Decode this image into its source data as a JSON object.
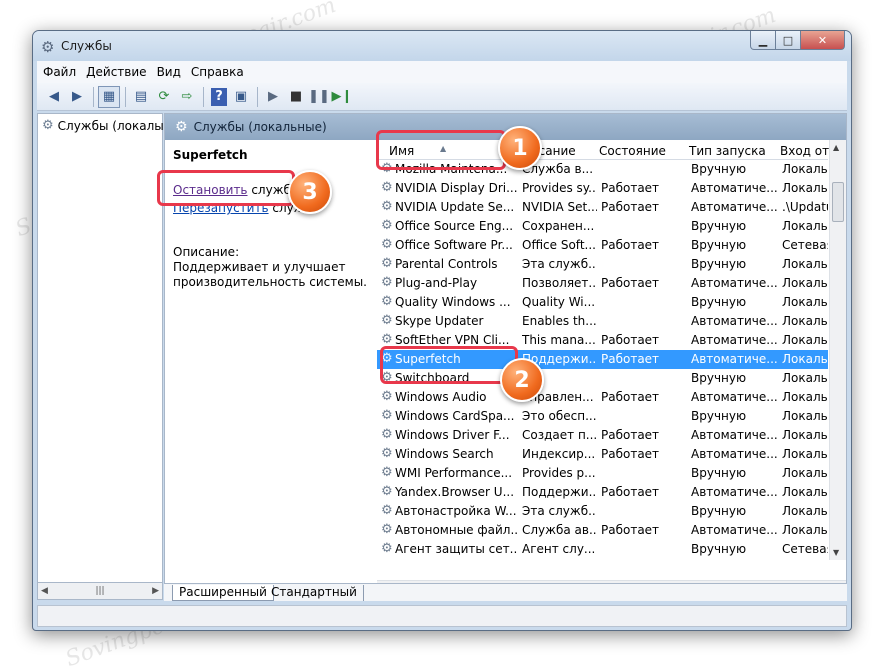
{
  "window": {
    "title": "Службы",
    "buttons": {
      "minimize": "▁",
      "maximize": "□",
      "close": "✕"
    }
  },
  "menu": [
    {
      "label": "Файл"
    },
    {
      "label": "Действие"
    },
    {
      "label": "Вид"
    },
    {
      "label": "Справка"
    }
  ],
  "toolbar": {
    "icons": [
      "back-arrow-icon",
      "forward-arrow-icon",
      "show-tree-icon",
      "properties-icon",
      "refresh-icon",
      "export-icon",
      "help-icon",
      "mmc-icon",
      "play-icon",
      "stop-icon",
      "pause-icon",
      "restart-icon"
    ]
  },
  "tree": {
    "item": "Службы (локалы"
  },
  "content": {
    "header": "Службы (локальные)",
    "selected_service": "Superfetch",
    "stop_link": "Остановить",
    "stop_suffix": " службу",
    "restart_link": "Перезапустить",
    "restart_suffix": " служб",
    "desc_label": "Описание:",
    "desc_text": "Поддерживает и улучшает производительность системы."
  },
  "columns": {
    "name": "Имя",
    "desc": "писание",
    "state": "Состояние",
    "startup": "Тип запуска",
    "logon": "Вход от и"
  },
  "services": [
    {
      "name": "Mozilla Maintena...",
      "desc": "Служба в...",
      "state": "",
      "startup": "Вручную",
      "logon": "Локальн"
    },
    {
      "name": "NVIDIA Display Dri...",
      "desc": "Provides sy...",
      "state": "Работает",
      "startup": "Автоматиче...",
      "logon": "Локальн"
    },
    {
      "name": "NVIDIA Update Se...",
      "desc": "NVIDIA Set...",
      "state": "Работает",
      "startup": "Автоматиче...",
      "logon": ".\\Updatus"
    },
    {
      "name": "Office  Source Eng...",
      "desc": "Сохранен...",
      "state": "",
      "startup": "Вручную",
      "logon": "Локальн"
    },
    {
      "name": "Office Software Pr...",
      "desc": "Office Soft...",
      "state": "Работает",
      "startup": "Вручную",
      "logon": "Сетевая с"
    },
    {
      "name": "Parental Controls",
      "desc": "Эта служб...",
      "state": "",
      "startup": "Вручную",
      "logon": "Локальн"
    },
    {
      "name": "Plug-and-Play",
      "desc": "Позволяет...",
      "state": "Работает",
      "startup": "Автоматиче...",
      "logon": "Локальн"
    },
    {
      "name": "Quality Windows ...",
      "desc": "Quality Wi...",
      "state": "",
      "startup": "Вручную",
      "logon": "Локальн"
    },
    {
      "name": "Skype Updater",
      "desc": "Enables th...",
      "state": "",
      "startup": "Автоматиче...",
      "logon": "Локальн"
    },
    {
      "name": "SoftEther VPN Cli...",
      "desc": "This mana...",
      "state": "Работает",
      "startup": "Автоматиче...",
      "logon": "Локальн"
    },
    {
      "name": "Superfetch",
      "desc": "Поддержи...",
      "state": "Работает",
      "startup": "Автоматиче...",
      "logon": "Локальн",
      "selected": true
    },
    {
      "name": "Switchboard",
      "desc": "",
      "state": "",
      "startup": "Вручную",
      "logon": "Локальн"
    },
    {
      "name": "Windows Audio",
      "desc": "Управлен...",
      "state": "Работает",
      "startup": "Автоматиче...",
      "logon": "Локальн"
    },
    {
      "name": "Windows CardSpa...",
      "desc": "Это обесп...",
      "state": "",
      "startup": "Вручную",
      "logon": "Локальн"
    },
    {
      "name": "Windows Driver F...",
      "desc": "Создает п...",
      "state": "Работает",
      "startup": "Автоматиче...",
      "logon": "Локальн"
    },
    {
      "name": "Windows Search",
      "desc": "Индексир...",
      "state": "Работает",
      "startup": "Автоматиче...",
      "logon": "Локальн"
    },
    {
      "name": "WMI Performance...",
      "desc": "Provides p...",
      "state": "",
      "startup": "Вручную",
      "logon": "Локальн"
    },
    {
      "name": "Yandex.Browser U...",
      "desc": "Поддержи...",
      "state": "Работает",
      "startup": "Автоматиче...",
      "logon": "Локальн"
    },
    {
      "name": "Автонастройка W...",
      "desc": "Эта служб...",
      "state": "",
      "startup": "Вручную",
      "logon": "Локальн"
    },
    {
      "name": "Автономные файл...",
      "desc": "Служба ав...",
      "state": "Работает",
      "startup": "Автоматиче...",
      "logon": "Локальн"
    },
    {
      "name": "Агент защиты сет...",
      "desc": "Агент слу...",
      "state": "",
      "startup": "Вручную",
      "logon": "Сетевая с"
    }
  ],
  "tabs": {
    "extended": "Расширенный",
    "standard": "Стандартный"
  },
  "badges": {
    "one": "1",
    "two": "2",
    "three": "3"
  },
  "watermark": "Sovingpcrepair.com",
  "accent_colors": {
    "selection": "#3399ff",
    "callout": "#e8384b",
    "badge": "#f06a1e"
  }
}
